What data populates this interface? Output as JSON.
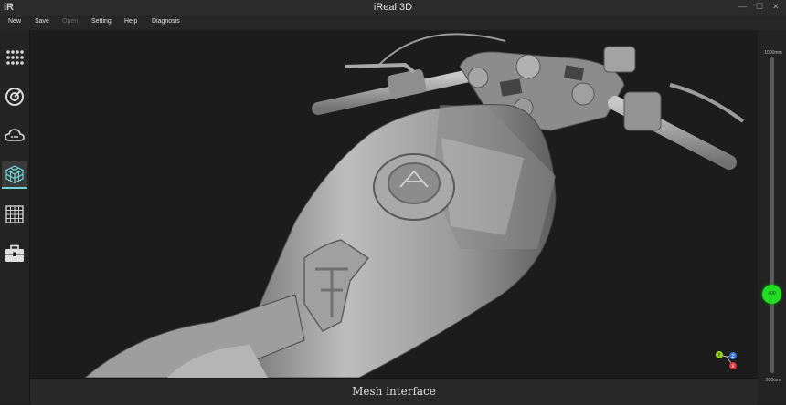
{
  "window": {
    "logo": "iR",
    "title": "iReal 3D",
    "minimize": "—",
    "maximize": "☐",
    "close": "✕"
  },
  "menu": [
    {
      "label": "New",
      "enabled": true
    },
    {
      "label": "Save",
      "enabled": true
    },
    {
      "label": "Open",
      "enabled": false
    },
    {
      "label": "Setting",
      "enabled": true
    },
    {
      "label": "Help",
      "enabled": true
    },
    {
      "label": "Diagnosis",
      "enabled": true
    }
  ],
  "sidebar": {
    "items": [
      {
        "icon": "dot-grid-icon"
      },
      {
        "icon": "scan-target-icon"
      },
      {
        "icon": "cloud-icon"
      },
      {
        "icon": "mesh-cube-icon",
        "active": true
      },
      {
        "icon": "grid-icon"
      },
      {
        "icon": "toolbox-icon"
      }
    ]
  },
  "depth_slider": {
    "max_label": "1000mm",
    "min_label": "200mm",
    "value_label": "400",
    "level_fraction": 0.75
  },
  "axes": {
    "x": "X",
    "y": "Y",
    "z": "Z"
  },
  "status": {
    "text": "Mesh interface"
  },
  "colors": {
    "accent": "#6fd3d3",
    "slider_knob": "#22dd22"
  }
}
